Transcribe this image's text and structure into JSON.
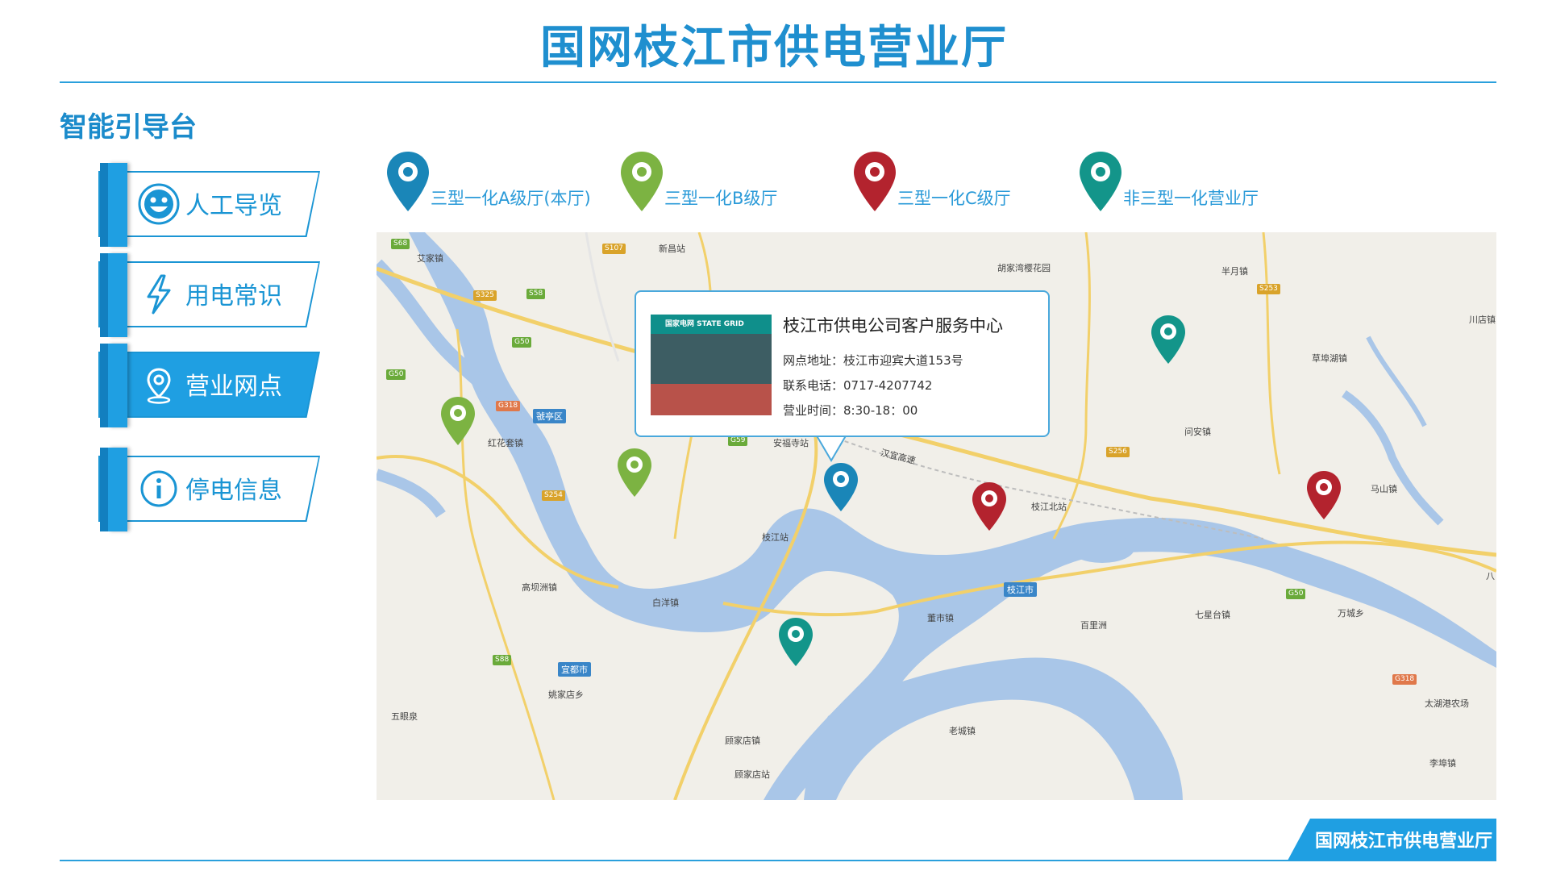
{
  "header": {
    "title": "国网枝江市供电营业厅"
  },
  "section": {
    "title": "智能引导台"
  },
  "menu": [
    {
      "label": "人工导览",
      "icon": "smiley-icon"
    },
    {
      "label": "用电常识",
      "icon": "lightning-icon"
    },
    {
      "label": "营业网点",
      "icon": "location-pin-icon",
      "active": true
    },
    {
      "label": "停电信息",
      "icon": "info-icon"
    }
  ],
  "legend": [
    {
      "label": "三型一化A级厅(本厅)",
      "color": "#1a86b8"
    },
    {
      "label": "三型一化B级厅",
      "color": "#7cb342"
    },
    {
      "label": "三型一化C级厅",
      "color": "#b3232e"
    },
    {
      "label": "非三型一化营业厅",
      "color": "#13958a"
    }
  ],
  "map": {
    "places": [
      "艾家镇",
      "新昌站",
      "胡家湾樱花园",
      "半月镇",
      "川店镇",
      "草埠湖镇",
      "虢亭区",
      "红花套镇",
      "安福寺站",
      "问安镇",
      "枝江北站",
      "马山镇",
      "枝江站",
      "高坝洲镇",
      "白洋镇",
      "董市镇",
      "枝江市",
      "百里洲",
      "七星台镇",
      "万城乡",
      "宜都市",
      "姚家店乡",
      "五眼泉",
      "顾家店镇",
      "顾家店站",
      "老城镇",
      "太湖港农场",
      "李埠镇",
      "汉宜高速",
      "八"
    ],
    "roads": [
      "S68",
      "G50",
      "S58",
      "G318",
      "S254",
      "S325",
      "S107",
      "G59",
      "S256",
      "S253",
      "S88",
      "G50",
      "G50",
      "G318"
    ]
  },
  "popup": {
    "title": "枝江市供电公司客户服务中心",
    "logo_text": "国家电网 STATE GRID",
    "address_label": "网点地址：",
    "address": "枝江市迎宾大道153号",
    "phone_label": "联系电话：",
    "phone": "0717-4207742",
    "hours_label": "营业时间：",
    "hours": "8:30-18：00"
  },
  "footer": {
    "badge": "国网枝江市供电营业厅"
  }
}
